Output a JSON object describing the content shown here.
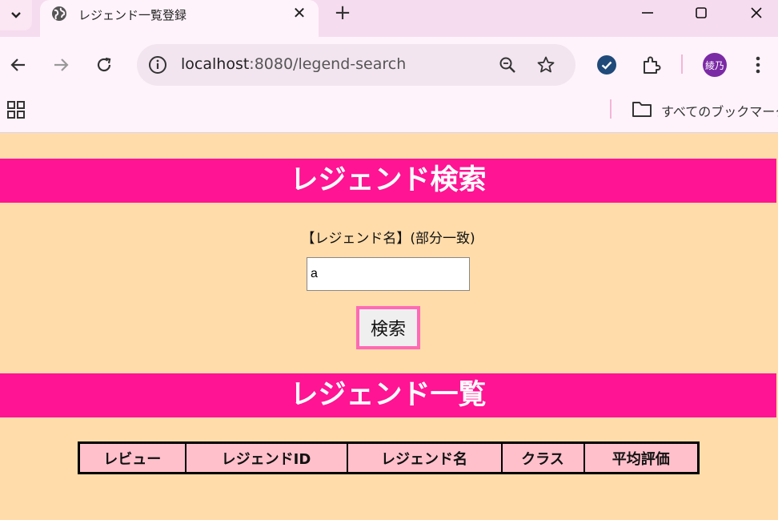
{
  "browser": {
    "tab_title": "レジェンド一覧登録",
    "url_host": "localhost",
    "url_rest": ":8080/legend-search",
    "bookmarks_label": "すべてのブックマーク",
    "avatar_text": "綾乃"
  },
  "search_section": {
    "heading": "レジェンド検索",
    "label": "【レジェンド名】(部分一致)",
    "input_value": "a",
    "button_label": "検索"
  },
  "list_section": {
    "heading": "レジェンド一覧",
    "columns": [
      "レビュー",
      "レジェンドID",
      "レジェンド名",
      "クラス",
      "平均評価"
    ]
  },
  "colors": {
    "page_bg": "#ffdcaa",
    "banner_bg": "#ff1493",
    "table_header_bg": "#ffc0cb",
    "button_border": "#ff69b4"
  }
}
